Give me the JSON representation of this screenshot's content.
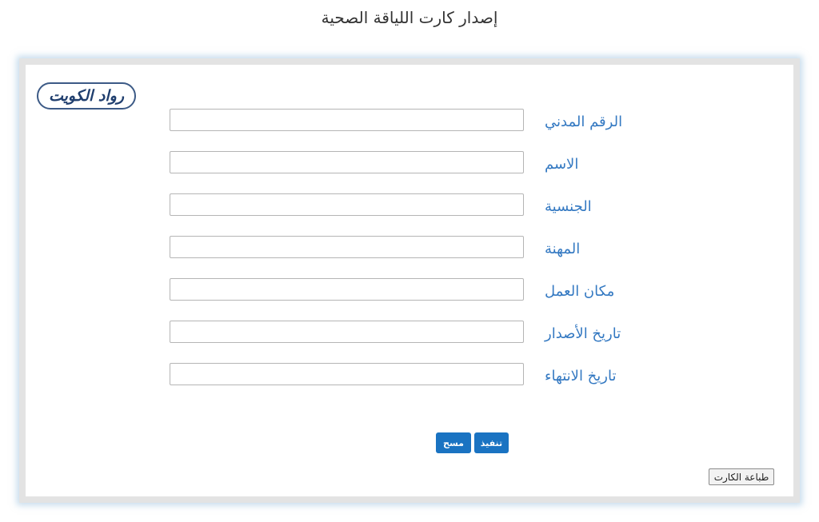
{
  "page": {
    "title": "إصدار كارت اللياقة الصحية"
  },
  "logo": {
    "text": "رواد الكويت"
  },
  "form": {
    "fields": [
      {
        "label": "الرقم المدني",
        "value": ""
      },
      {
        "label": "الاسم",
        "value": ""
      },
      {
        "label": "الجنسية",
        "value": ""
      },
      {
        "label": "المهنة",
        "value": ""
      },
      {
        "label": "مكان العمل",
        "value": ""
      },
      {
        "label": "تاريخ الأصدار",
        "value": ""
      },
      {
        "label": "تاريخ الانتهاء",
        "value": ""
      }
    ]
  },
  "actions": {
    "execute_label": "تنفيذ",
    "clear_label": "مسح",
    "print_label": "طباعة الكارت"
  },
  "colors": {
    "label": "#3479c2",
    "primary_button": "#1a73c2",
    "frame_border": "#e3e3e3"
  }
}
